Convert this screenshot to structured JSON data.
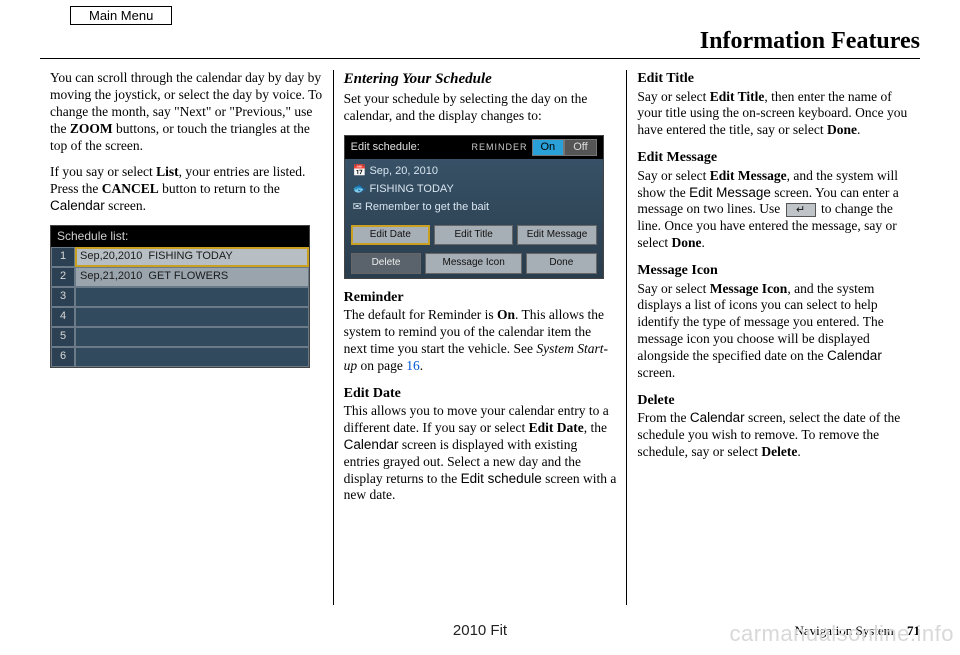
{
  "main_menu_label": "Main Menu",
  "page_title": "Information Features",
  "col1": {
    "p1_a": "You can scroll through the calendar day by day by moving the joystick, or select the day by voice. To change the month, say \"Next\" or \"Previous,\" use the ",
    "p1_zoom": "ZOOM",
    "p1_b": " buttons, or touch the triangles at the top of the screen.",
    "p2_a": "If you say or select ",
    "p2_list": "List",
    "p2_b": ", your entries are listed. Press the ",
    "p2_cancel": "CANCEL",
    "p2_c": " button to return to the ",
    "p2_cal": "Calendar",
    "p2_d": " screen."
  },
  "schedule_list": {
    "header": "Schedule list:",
    "rows": [
      {
        "n": "1",
        "date": "Sep,20,2010",
        "text": "FISHING TODAY",
        "selected": true
      },
      {
        "n": "2",
        "date": "Sep,21,2010",
        "text": "GET FLOWERS",
        "selected": false
      },
      {
        "n": "3",
        "date": "",
        "text": "",
        "selected": false
      },
      {
        "n": "4",
        "date": "",
        "text": "",
        "selected": false
      },
      {
        "n": "5",
        "date": "",
        "text": "",
        "selected": false
      },
      {
        "n": "6",
        "date": "",
        "text": "",
        "selected": false
      }
    ]
  },
  "col2": {
    "head": "Entering Your Schedule",
    "intro": "Set your schedule by selecting the day on the calendar, and the display changes to:",
    "edit": {
      "title": "Edit schedule:",
      "reminder_label": "REMINDER",
      "on": "On",
      "off": "Off",
      "line1": "Sep, 20, 2010",
      "line2": "FISHING TODAY",
      "line3": "Remember to get the bait",
      "btn_edit_date": "Edit Date",
      "btn_edit_title": "Edit Title",
      "btn_edit_msg": "Edit Message",
      "btn_delete": "Delete",
      "btn_msg_icon": "Message Icon",
      "btn_done": "Done"
    },
    "reminder_head": "Reminder",
    "reminder_a": "The default for Reminder is ",
    "reminder_on": "On",
    "reminder_b": ". This allows the system to remind you of the calendar item the next time you start the vehicle. See ",
    "reminder_ref": "System Start-up",
    "reminder_c": " on page ",
    "reminder_pg": "16",
    "reminder_d": ".",
    "editdate_head": "Edit Date",
    "editdate_a": "This allows you to move your calendar entry to a different date. If you say or select ",
    "editdate_bold": "Edit Date",
    "editdate_b": ", the ",
    "editdate_cal": "Calendar",
    "editdate_c": " screen is displayed with existing entries grayed out. Select a new day and the display returns to the ",
    "editdate_sched": "Edit schedule",
    "editdate_d": " screen with a new date."
  },
  "col3": {
    "edittitle_head": "Edit Title",
    "edittitle_a": "Say or select ",
    "edittitle_bold": "Edit Title",
    "edittitle_b": ", then enter the name of your title using the on-screen keyboard. Once you have entered the title, say or select ",
    "edittitle_done": "Done",
    "edittitle_c": ".",
    "editmsg_head": "Edit Message",
    "editmsg_a": "Say or select ",
    "editmsg_bold": "Edit Message",
    "editmsg_b": ", and the system will show the ",
    "editmsg_scr": "Edit Message",
    "editmsg_c": " screen. You can enter a message on two lines. Use ",
    "editmsg_d": " to change the line. Once you have entered the message, say or select ",
    "editmsg_done": "Done",
    "editmsg_e": ".",
    "msgicon_head": "Message Icon",
    "msgicon_a": "Say or select ",
    "msgicon_bold": "Message Icon",
    "msgicon_b": ", and the system displays a list of icons you can select to help identify the type of message you entered. The message icon you choose will be displayed alongside the specified date on the ",
    "msgicon_cal": "Calendar",
    "msgicon_c": " screen.",
    "delete_head": "Delete",
    "delete_a": "From the ",
    "delete_cal": "Calendar",
    "delete_b": " screen, select the date of the schedule you wish to remove. To remove the schedule, say or select ",
    "delete_bold": "Delete",
    "delete_c": "."
  },
  "footer": {
    "model": "2010 Fit",
    "section": "Navigation System",
    "page": "71"
  },
  "watermark": "carmanualsonline.info"
}
